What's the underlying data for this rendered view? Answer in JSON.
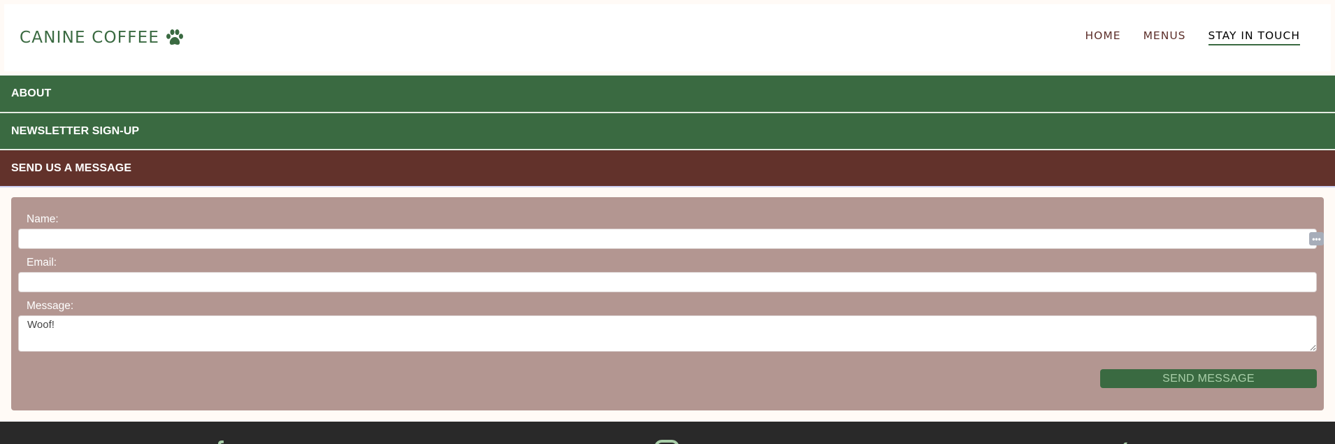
{
  "brand": {
    "name": "CANINE COFFEE",
    "icon": "paw-icon",
    "color": "#3a6a41"
  },
  "nav": {
    "items": [
      "HOME",
      "MENUS",
      "STAY IN TOUCH"
    ],
    "active": "STAY IN TOUCH"
  },
  "accordion": {
    "about": "ABOUT",
    "newsletter": "NEWSLETTER SIGN-UP",
    "message": "SEND US A MESSAGE"
  },
  "form": {
    "name_label": "Name:",
    "name_value": "",
    "email_label": "Email:",
    "email_value": "",
    "message_label": "Message:",
    "message_value": "Woof!",
    "submit_label": "SEND MESSAGE"
  },
  "footer": {
    "icons": [
      "facebook-icon",
      "instagram-icon",
      "twitter-icon"
    ]
  },
  "colors": {
    "green": "#3a6a41",
    "brown": "#62322b",
    "form_bg": "#b39691",
    "footer_bg": "#292929",
    "page_bg": "#fffaf6"
  }
}
